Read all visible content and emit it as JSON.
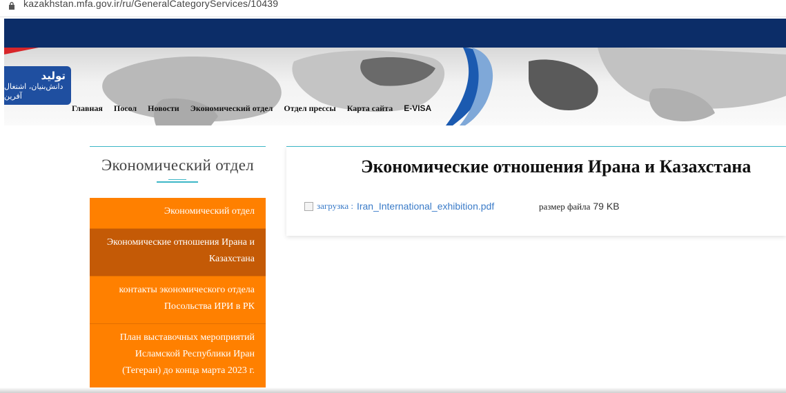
{
  "browser": {
    "url": "kazakhstan.mfa.gov.ir/ru/GeneralCategoryServices/10439"
  },
  "logo": {
    "line1": "تولید",
    "line2": "دانش‌بنیان، اشتغال آفرین"
  },
  "nav": {
    "items": [
      "Главная",
      "Посол",
      "Новости",
      "Экономический отдел",
      "Отдел прессы",
      "Карта сайта",
      "E-VISA"
    ]
  },
  "sidebar": {
    "title": "Экономический отдел",
    "items": [
      {
        "label": "Экономический отдел",
        "active": false
      },
      {
        "label": "Экономические отношения Ирана и Казахстана",
        "active": true
      },
      {
        "label": "контакты экономического отдела Посольства ИРИ в РК",
        "active": false
      },
      {
        "label": "План выставочных мероприятий Исламской Республики Иран (Тегеран) до конца марта 2023 г.",
        "active": false
      }
    ]
  },
  "content": {
    "title": "Экономические отношения Ирана и Казахстана",
    "download_label": "загрузка :",
    "file_name": "Iran_International_exhibition.pdf",
    "size_label": "размер файла",
    "size_value": "79 KB"
  },
  "colors": {
    "navy": "#0c2d68",
    "accent_teal": "#3bb6c6",
    "menu_orange": "#ff8000",
    "menu_active": "#c45a06",
    "link_blue": "#3a7bc8"
  }
}
